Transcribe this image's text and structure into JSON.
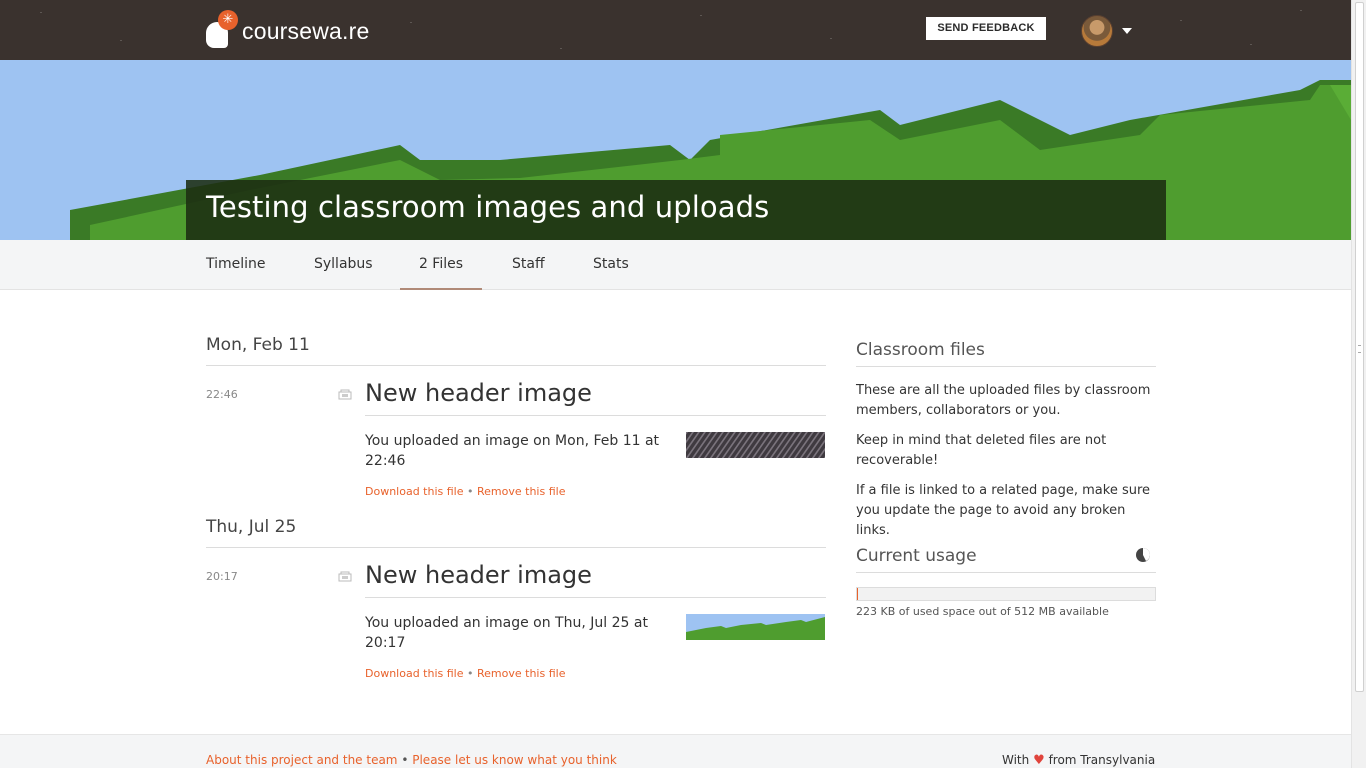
{
  "header": {
    "logo_text": "coursewa.re",
    "logo_icon": "asterisk-icon",
    "feedback_label": "SEND FEEDBACK"
  },
  "classroom": {
    "title": "Testing classroom images and uploads"
  },
  "tabs": [
    {
      "label": "Timeline"
    },
    {
      "label": "Syllabus"
    },
    {
      "label": "2 Files",
      "active": true
    },
    {
      "label": "Staff"
    },
    {
      "label": "Stats"
    }
  ],
  "timeline": [
    {
      "date": "Mon, Feb 11",
      "time": "22:46",
      "title": "New header image",
      "text": "You uploaded an image on Mon, Feb 11 at 22:46",
      "download_label": "Download this file",
      "separator": "•",
      "remove_label": "Remove this file"
    },
    {
      "date": "Thu, Jul 25",
      "time": "20:17",
      "title": "New header image",
      "text": "You uploaded an image on Thu, Jul 25 at 20:17",
      "download_label": "Download this file",
      "separator": "•",
      "remove_label": "Remove this file"
    }
  ],
  "sidebar": {
    "files_heading": "Classroom files",
    "p1": "These are all the uploaded files by classroom members, collaborators or you.",
    "p2": "Keep in mind that deleted files are not recoverable!",
    "p3": "If a file is linked to a related page, make sure you update the page to avoid any broken links.",
    "usage_heading": "Current usage",
    "usage_fraction": 0.0004,
    "usage_text": "223 KB of used space out of 512 MB available"
  },
  "footer": {
    "about_link": "About this project and the team",
    "separator": "•",
    "feedback_link": "Please let us know what you think",
    "credit_prefix": "With",
    "credit_suffix": "from Transylvania"
  },
  "colors": {
    "accent": "#e8622c",
    "topbar": "#3a322e",
    "sky": "#9ec3f2",
    "grass": "#4f9d2f"
  }
}
